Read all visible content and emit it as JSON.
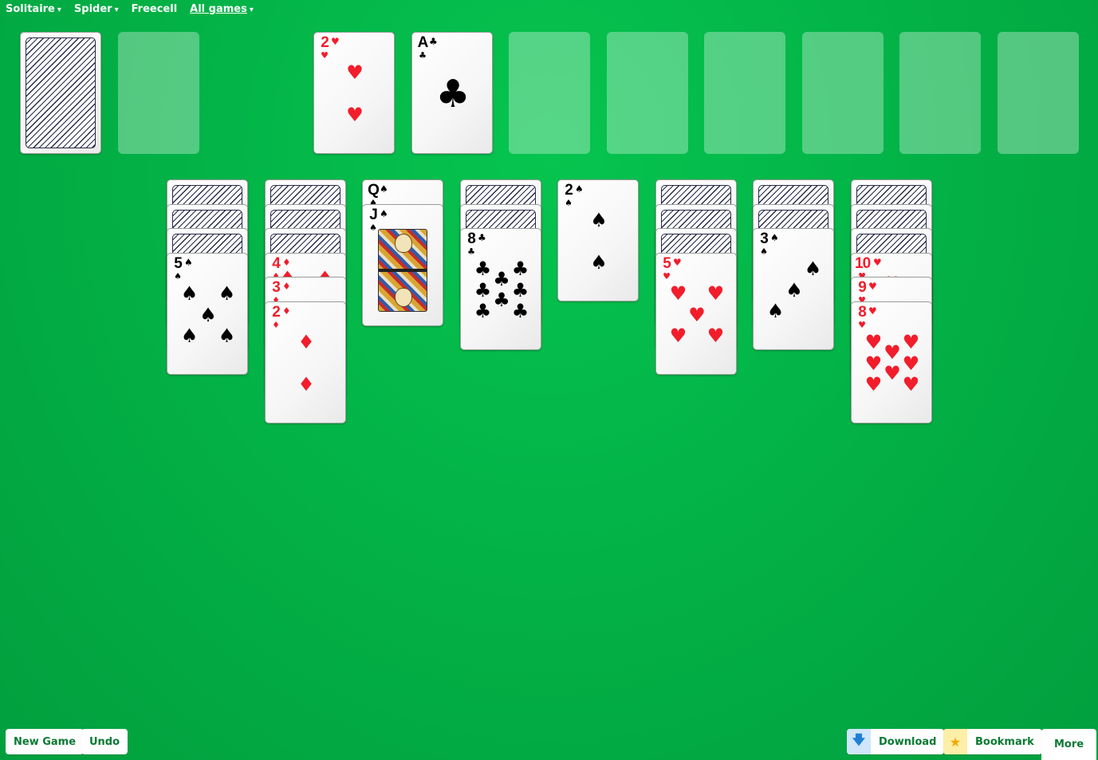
{
  "nav": {
    "solitaire": "Solitaire",
    "spider": "Spider",
    "freecell": "Freecell",
    "all_games": "All games",
    "caret": "▾"
  },
  "suits": {
    "spade": "♠",
    "heart": "♥",
    "diamond": "♦",
    "club": "♣"
  },
  "stock": {
    "cards": "face-down",
    "waste": "empty"
  },
  "foundations": [
    {
      "rank": "2",
      "suit": "heart"
    },
    {
      "rank": "A",
      "suit": "club"
    },
    {
      "rank": "",
      "suit": ""
    },
    {
      "rank": "",
      "suit": ""
    },
    {
      "rank": "",
      "suit": ""
    },
    {
      "rank": "",
      "suit": ""
    },
    {
      "rank": "",
      "suit": ""
    },
    {
      "rank": "",
      "suit": ""
    }
  ],
  "tableau": [
    {
      "hidden": 3,
      "cards": [
        {
          "rank": "5",
          "suit": "spade"
        }
      ]
    },
    {
      "hidden": 3,
      "cards": [
        {
          "rank": "4",
          "suit": "diamond"
        },
        {
          "rank": "3",
          "suit": "diamond"
        },
        {
          "rank": "2",
          "suit": "diamond"
        }
      ]
    },
    {
      "hidden": 0,
      "cards": [
        {
          "rank": "Q",
          "suit": "spade"
        },
        {
          "rank": "J",
          "suit": "spade"
        }
      ]
    },
    {
      "hidden": 2,
      "cards": [
        {
          "rank": "8",
          "suit": "club"
        }
      ]
    },
    {
      "hidden": 0,
      "cards": [
        {
          "rank": "2",
          "suit": "spade"
        }
      ]
    },
    {
      "hidden": 3,
      "cards": [
        {
          "rank": "5",
          "suit": "heart"
        }
      ]
    },
    {
      "hidden": 2,
      "cards": [
        {
          "rank": "3",
          "suit": "spade"
        }
      ]
    },
    {
      "hidden": 3,
      "cards": [
        {
          "rank": "10",
          "suit": "heart"
        },
        {
          "rank": "9",
          "suit": "heart"
        },
        {
          "rank": "8",
          "suit": "heart"
        }
      ]
    }
  ],
  "buttons": {
    "new_game": "New Game",
    "undo": "Undo",
    "download": "Download",
    "bookmark": "Bookmark",
    "more": "More"
  },
  "icons": {
    "download": "download-arrow-icon",
    "bookmark": "star-icon"
  },
  "colors": {
    "felt": "#03b548",
    "red_suit": "#f21d2b",
    "button_text": "#0a7a33",
    "download_icon_bg": "#cfe6fb",
    "bookmark_icon_bg": "#fdefa8"
  }
}
